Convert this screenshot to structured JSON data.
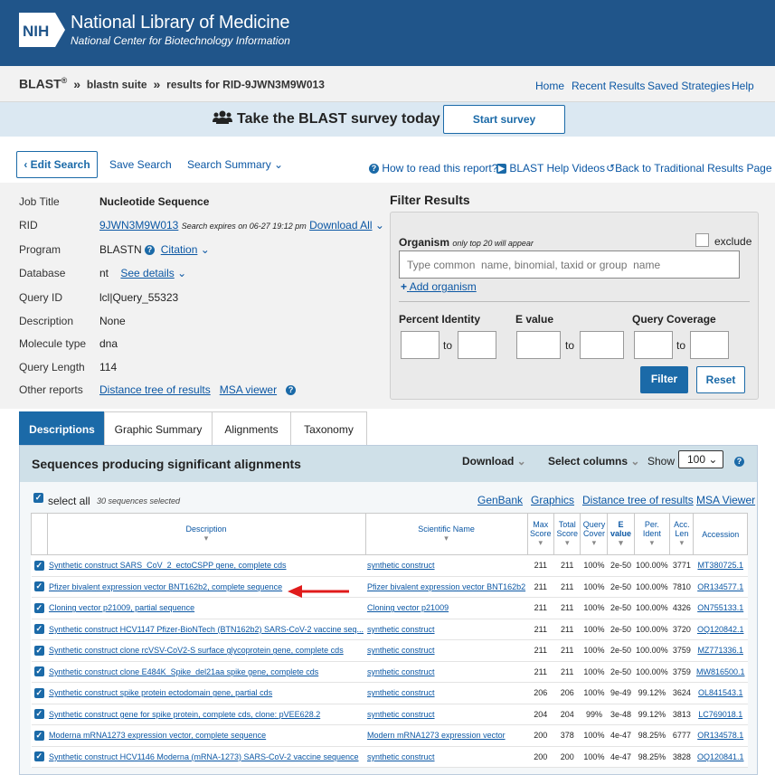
{
  "header": {
    "logo": "NIH",
    "title": "National Library of Medicine",
    "subtitle": "National Center for Biotechnology Information"
  },
  "breadcrumb": {
    "blast": "BLAST",
    "reg": "®",
    "sep": "»",
    "suite": "blastn suite",
    "results": "results for RID-9JWN3M9W013"
  },
  "topnav": [
    "Home",
    "Recent Results",
    "Saved Strategies",
    "Help"
  ],
  "survey": {
    "text": "Take the BLAST survey today",
    "button": "Start survey"
  },
  "actions": {
    "edit": "Edit Search",
    "save": "Save Search",
    "summary": "Search Summary",
    "howto": "How to read this report?",
    "videos": "BLAST Help Videos",
    "back": "Back to Traditional Results Page"
  },
  "job": {
    "title_label": "Job Title",
    "title_value": "Nucleotide Sequence",
    "rid_label": "RID",
    "rid_value": "9JWN3M9W013",
    "rid_note": "Search expires on 06-27 19:12 pm",
    "download_all": "Download All",
    "program_label": "Program",
    "program_value": "BLASTN",
    "citation": "Citation",
    "database_label": "Database",
    "database_value": "nt",
    "see_details": "See details",
    "query_label": "Query ID",
    "query_value": "lcl|Query_55323",
    "desc_label": "Description",
    "desc_value": "None",
    "mol_label": "Molecule type",
    "mol_value": "dna",
    "len_label": "Query Length",
    "len_value": "114",
    "other_label": "Other reports",
    "distance_tree": "Distance tree of results",
    "msa_viewer": "MSA viewer"
  },
  "filter": {
    "title": "Filter Results",
    "organism_label": "Organism",
    "organism_note": "only top 20 will appear",
    "exclude": "exclude",
    "placeholder": "Type common  name, binomial, taxid or group  name",
    "add_organism": "Add organism",
    "percent_identity": "Percent Identity",
    "evalue": "E value",
    "query_coverage": "Query Coverage",
    "to": "to",
    "filter_btn": "Filter",
    "reset_btn": "Reset"
  },
  "tabs": [
    "Descriptions",
    "Graphic Summary",
    "Alignments",
    "Taxonomy"
  ],
  "results_panel": {
    "title": "Sequences producing significant alignments",
    "download": "Download",
    "select_columns": "Select columns",
    "show": "Show",
    "show_value": "100",
    "select_all": "select all",
    "selected_count": "30 sequences selected",
    "links": [
      "GenBank",
      "Graphics",
      "Distance tree of results",
      "MSA Viewer"
    ]
  },
  "columns": [
    "Description",
    "Scientific Name",
    "Max Score",
    "Total Score",
    "Query Cover",
    "E value",
    "Per. Ident",
    "Acc. Len",
    "Accession"
  ],
  "rows": [
    {
      "description": "Synthetic construct SARS_CoV_2_ectoCSPP gene, complete cds",
      "sci": "synthetic construct",
      "max": "211",
      "total": "211",
      "cover": "100%",
      "evalue": "2e-50",
      "ident": "100.00%",
      "len": "3771",
      "acc": "MT380725.1"
    },
    {
      "description": "Pfizer bivalent expression vector BNT162b2, complete sequence",
      "sci": "Pfizer bivalent expression vector BNT162b2",
      "max": "211",
      "total": "211",
      "cover": "100%",
      "evalue": "2e-50",
      "ident": "100.00%",
      "len": "7810",
      "acc": "OR134577.1"
    },
    {
      "description": "Cloning vector p21009, partial sequence",
      "sci": "Cloning vector p21009",
      "max": "211",
      "total": "211",
      "cover": "100%",
      "evalue": "2e-50",
      "ident": "100.00%",
      "len": "4326",
      "acc": "ON755133.1"
    },
    {
      "description": "Synthetic construct HCV1147 Pfizer-BioNTech (BTN162b2) SARS-CoV-2 vaccine seq...",
      "sci": "synthetic construct",
      "max": "211",
      "total": "211",
      "cover": "100%",
      "evalue": "2e-50",
      "ident": "100.00%",
      "len": "3720",
      "acc": "OQ120842.1"
    },
    {
      "description": "Synthetic construct clone rcVSV-CoV2-S surface glycoprotein gene, complete cds",
      "sci": "synthetic construct",
      "max": "211",
      "total": "211",
      "cover": "100%",
      "evalue": "2e-50",
      "ident": "100.00%",
      "len": "3759",
      "acc": "MZ771336.1"
    },
    {
      "description": "Synthetic construct clone E484K_Spike_del21aa spike gene, complete cds",
      "sci": "synthetic construct",
      "max": "211",
      "total": "211",
      "cover": "100%",
      "evalue": "2e-50",
      "ident": "100.00%",
      "len": "3759",
      "acc": "MW816500.1"
    },
    {
      "description": "Synthetic construct spike protein ectodomain gene, partial cds",
      "sci": "synthetic construct",
      "max": "206",
      "total": "206",
      "cover": "100%",
      "evalue": "9e-49",
      "ident": "99.12%",
      "len": "3624",
      "acc": "OL841543.1"
    },
    {
      "description": "Synthetic construct gene for spike protein, complete cds, clone: pVEE628.2",
      "sci": "synthetic construct",
      "max": "204",
      "total": "204",
      "cover": "99%",
      "evalue": "3e-48",
      "ident": "99.12%",
      "len": "3813",
      "acc": "LC769018.1"
    },
    {
      "description": "Moderna mRNA1273 expression vector, complete sequence",
      "sci": "Modern mRNA1273 expression vector",
      "max": "200",
      "total": "378",
      "cover": "100%",
      "evalue": "4e-47",
      "ident": "98.25%",
      "len": "6777",
      "acc": "OR134578.1"
    },
    {
      "description": "Synthetic construct HCV1146 Moderna (mRNA-1273) SARS-CoV-2 vaccine sequence",
      "sci": "synthetic construct",
      "max": "200",
      "total": "200",
      "cover": "100%",
      "evalue": "4e-47",
      "ident": "98.25%",
      "len": "3828",
      "acc": "OQ120841.1"
    }
  ],
  "colors": {
    "header": "#20558a",
    "accent": "#1b6aa8",
    "arrow": "#e01b1b"
  }
}
